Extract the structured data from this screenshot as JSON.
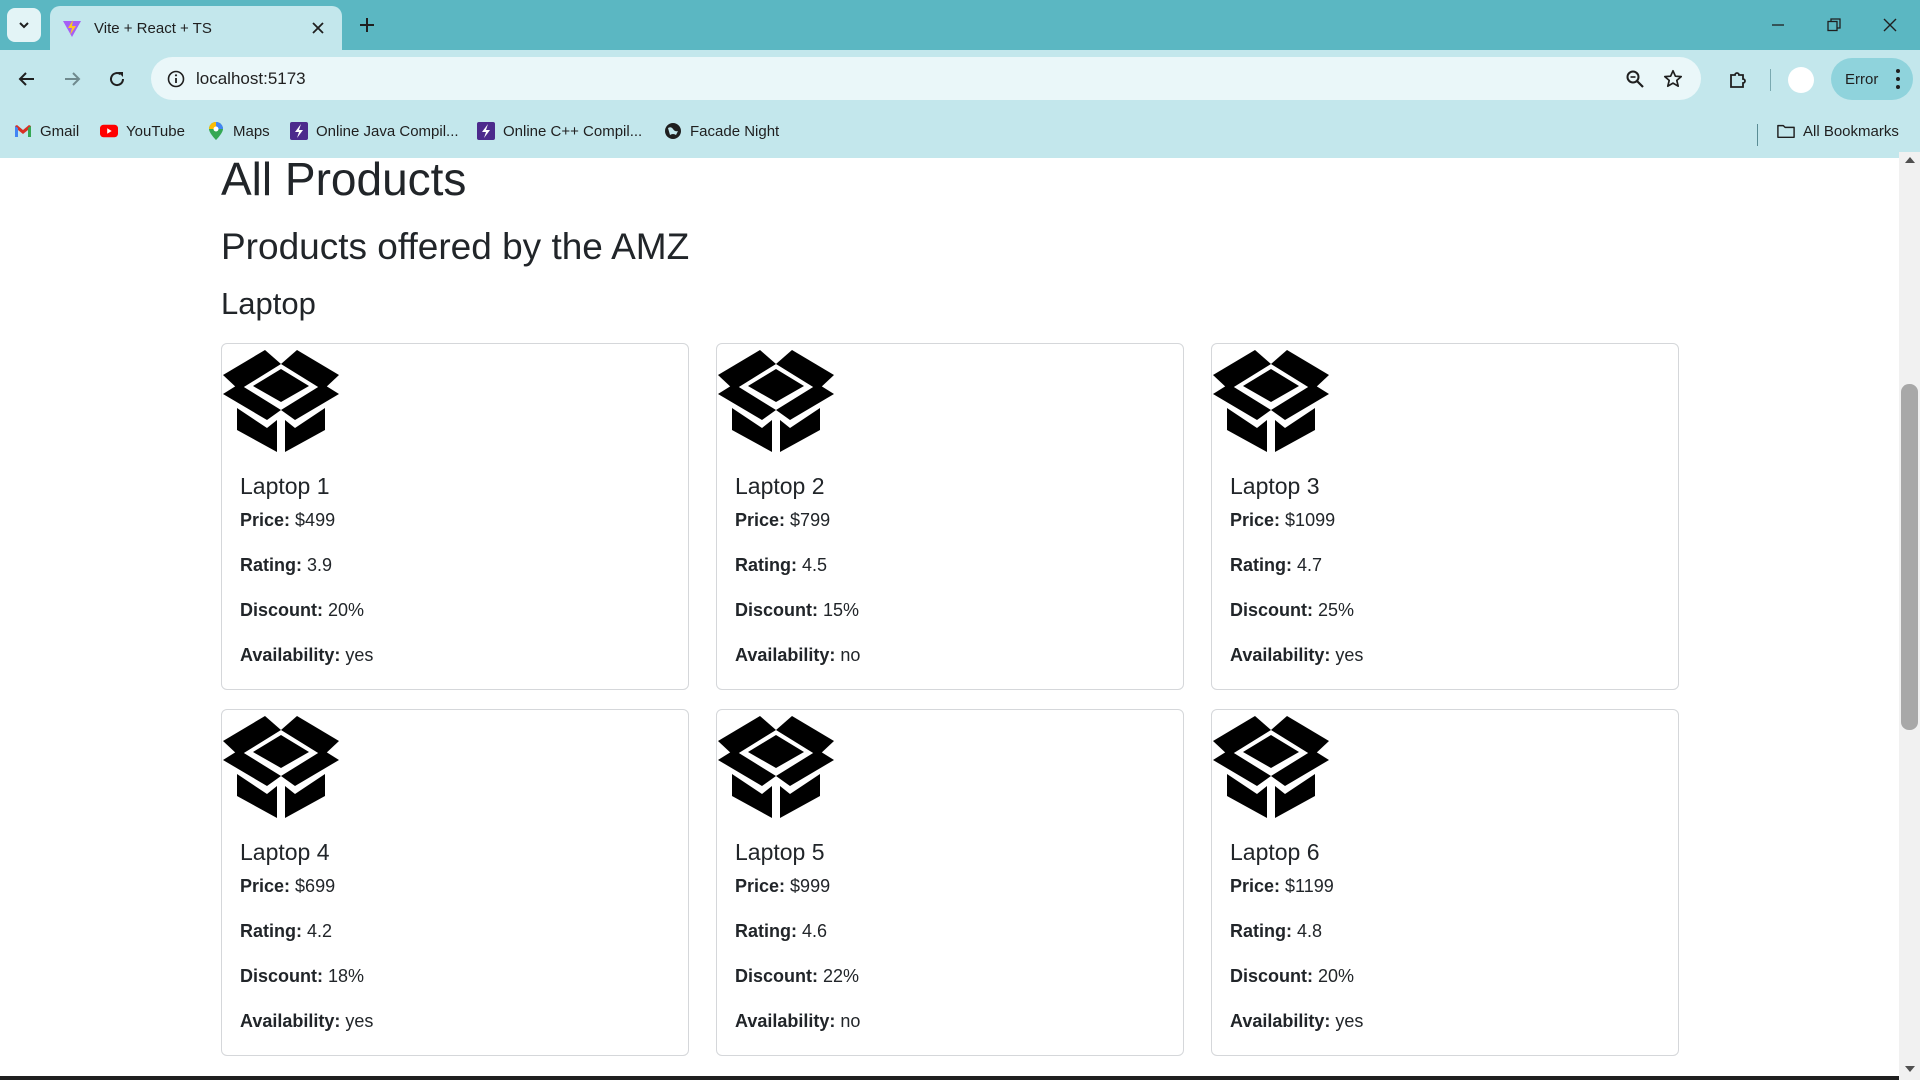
{
  "browser": {
    "tab_title": "Vite + React + TS",
    "url": "localhost:5173",
    "error_label": "Error",
    "bookmarks": [
      {
        "label": "Gmail",
        "icon": "gmail-icon"
      },
      {
        "label": "YouTube",
        "icon": "youtube-icon"
      },
      {
        "label": "Maps",
        "icon": "maps-icon"
      },
      {
        "label": "Online Java Compil...",
        "icon": "bolt-icon"
      },
      {
        "label": "Online C++ Compil...",
        "icon": "bolt-icon"
      },
      {
        "label": "Facade Night",
        "icon": "globe-icon"
      }
    ],
    "all_bookmarks": "All Bookmarks",
    "colors": {
      "tabstrip": "#5bb7c2",
      "toolbar": "#c3e7ec"
    }
  },
  "page": {
    "title": "All Products",
    "subtitle": "Products offered by the AMZ",
    "category": "Laptop",
    "labels": {
      "price": "Price:",
      "rating": "Rating:",
      "discount": "Discount:",
      "availability": "Availability:"
    },
    "products": [
      {
        "name": "Laptop 1",
        "price": "$499",
        "rating": "3.9",
        "discount": "20%",
        "availability": "yes"
      },
      {
        "name": "Laptop 2",
        "price": "$799",
        "rating": "4.5",
        "discount": "15%",
        "availability": "no"
      },
      {
        "name": "Laptop 3",
        "price": "$1099",
        "rating": "4.7",
        "discount": "25%",
        "availability": "yes"
      },
      {
        "name": "Laptop 4",
        "price": "$699",
        "rating": "4.2",
        "discount": "18%",
        "availability": "yes"
      },
      {
        "name": "Laptop 5",
        "price": "$999",
        "rating": "4.6",
        "discount": "22%",
        "availability": "no"
      },
      {
        "name": "Laptop 6",
        "price": "$1199",
        "rating": "4.8",
        "discount": "20%",
        "availability": "yes"
      }
    ]
  }
}
